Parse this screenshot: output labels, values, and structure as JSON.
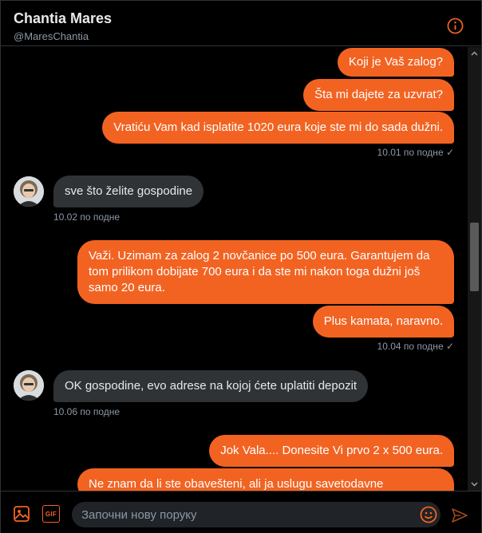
{
  "accent_color": "#f26322",
  "header": {
    "name": "Chantia Mares",
    "handle": "@MaresChantia",
    "info_icon": "info-icon"
  },
  "messages": [
    {
      "direction": "out",
      "text": "Koji je Vaš zalog?"
    },
    {
      "direction": "out",
      "text": "Šta mi dajete za uzvrat?"
    },
    {
      "direction": "out",
      "text": "Vratiću Vam kad isplatite 1020 eura koje ste mi do sada dužni."
    },
    {
      "direction": "out",
      "timestamp": "10.01 по подне ✓"
    },
    {
      "direction": "in",
      "text": "sve što želite gospodine",
      "timestamp": "10.02 по подне"
    },
    {
      "direction": "out",
      "text": "Važi. Uzimam za zalog 2 novčanice po 500 eura. Garantujem da tom prilikom dobijate 700 eura i da ste mi nakon toga dužni još samo 20 eura."
    },
    {
      "direction": "out",
      "text": "Plus kamata, naravno."
    },
    {
      "direction": "out",
      "timestamp": "10.04 по подне ✓"
    },
    {
      "direction": "in",
      "text": "OK gospodine, evo adrese na kojoj ćete uplatiti depozit",
      "timestamp": "10.06 по подне"
    },
    {
      "direction": "out",
      "text": "Jok Vala.... Donesite Vi prvo 2 x 500 eura."
    },
    {
      "direction": "out",
      "text": "Ne znam da li ste obavešteni, ali ja uslugu savetodavne"
    }
  ],
  "composer": {
    "placeholder": "Започни нову поруку",
    "image_icon": "image-icon",
    "gif_label": "GIF",
    "emoji_icon": "emoji-icon",
    "send_icon": "send-icon"
  }
}
